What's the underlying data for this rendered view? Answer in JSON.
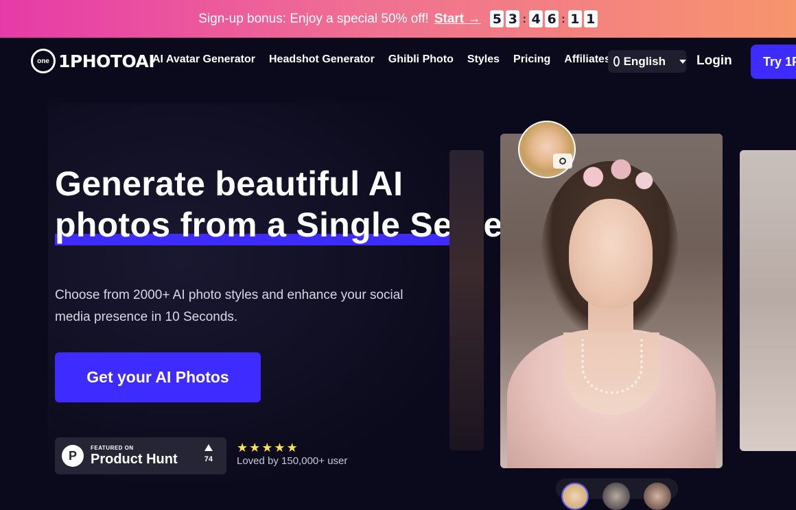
{
  "promo": {
    "text": "Sign-up bonus: Enjoy a special 50% off!",
    "start_label": "Start →",
    "countdown": [
      "5",
      "3",
      "4",
      "6",
      "1",
      "1"
    ]
  },
  "nav": {
    "logo_badge": "one",
    "logo_text": "1PHOTOAI",
    "links": [
      "AI Avatar Generator",
      "Headshot Generator",
      "Ghibli Photo",
      "Styles",
      "Pricing",
      "Affiliates"
    ],
    "language": "English",
    "login": "Login",
    "try_label": "Try 1P"
  },
  "hero": {
    "headline_line1": "Generate beautiful AI",
    "headline_line2": "photos from a Single Selfie",
    "subtitle": "Choose from 2000+ AI photo styles and enhance your social media presence in 10 Seconds.",
    "cta": "Get your AI Photos"
  },
  "producthunt": {
    "featured": "FEATURED ON",
    "name": "Product Hunt",
    "logo": "P",
    "votes": "74"
  },
  "rating": {
    "stars": 5,
    "star_glyph": "★",
    "loved_text": "Loved by 150,000+ user"
  },
  "colors": {
    "accent": "#3e2bff",
    "background": "#0b0a1c",
    "banner_start": "#e63aa8",
    "banner_end": "#f7956c",
    "star": "#ffe14a"
  },
  "icons": {
    "globe": "globe-icon",
    "caret": "chevron-down-icon",
    "camera": "camera-icon",
    "upvote": "upvote-arrow-icon"
  }
}
